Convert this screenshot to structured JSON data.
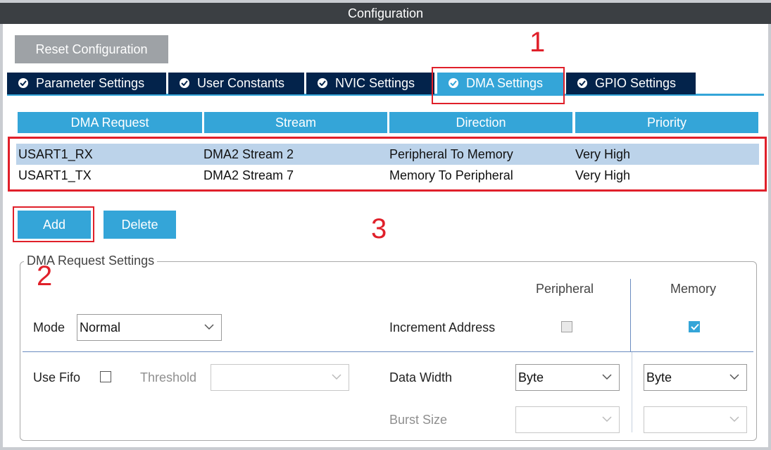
{
  "window": {
    "title": "Configuration"
  },
  "toolbar": {
    "reset_label": "Reset Configuration"
  },
  "tabs": [
    {
      "label": "Parameter Settings",
      "active": false
    },
    {
      "label": "User Constants",
      "active": false
    },
    {
      "label": "NVIC Settings",
      "active": false
    },
    {
      "label": "DMA Settings",
      "active": true
    },
    {
      "label": "GPIO Settings",
      "active": false
    }
  ],
  "table": {
    "columns": [
      "DMA Request",
      "Stream",
      "Direction",
      "Priority"
    ],
    "rows": [
      {
        "request": "USART1_RX",
        "stream": "DMA2 Stream 2",
        "direction": "Peripheral To Memory",
        "priority": "Very High",
        "selected": true
      },
      {
        "request": "USART1_TX",
        "stream": "DMA2 Stream 7",
        "direction": "Memory To Peripheral",
        "priority": "Very High",
        "selected": false
      }
    ]
  },
  "actions": {
    "add_label": "Add",
    "delete_label": "Delete"
  },
  "annotations": {
    "n1": "1",
    "n2": "2",
    "n3": "3"
  },
  "settings": {
    "group_title": "DMA Request Settings",
    "mode_label": "Mode",
    "mode_value": "Normal",
    "use_fifo_label": "Use Fifo",
    "use_fifo_checked": false,
    "threshold_label": "Threshold",
    "threshold_value": "",
    "peripheral_header": "Peripheral",
    "memory_header": "Memory",
    "increment_label": "Increment Address",
    "increment_peripheral": false,
    "increment_memory": true,
    "data_width_label": "Data Width",
    "data_width_peripheral": "Byte",
    "data_width_memory": "Byte",
    "burst_size_label": "Burst Size",
    "burst_peripheral": "",
    "burst_memory": ""
  },
  "colors": {
    "accent": "#34a5d8",
    "tab_dark": "#03234b",
    "highlight": "#e0202a",
    "row_selected": "#bcd3ea"
  }
}
